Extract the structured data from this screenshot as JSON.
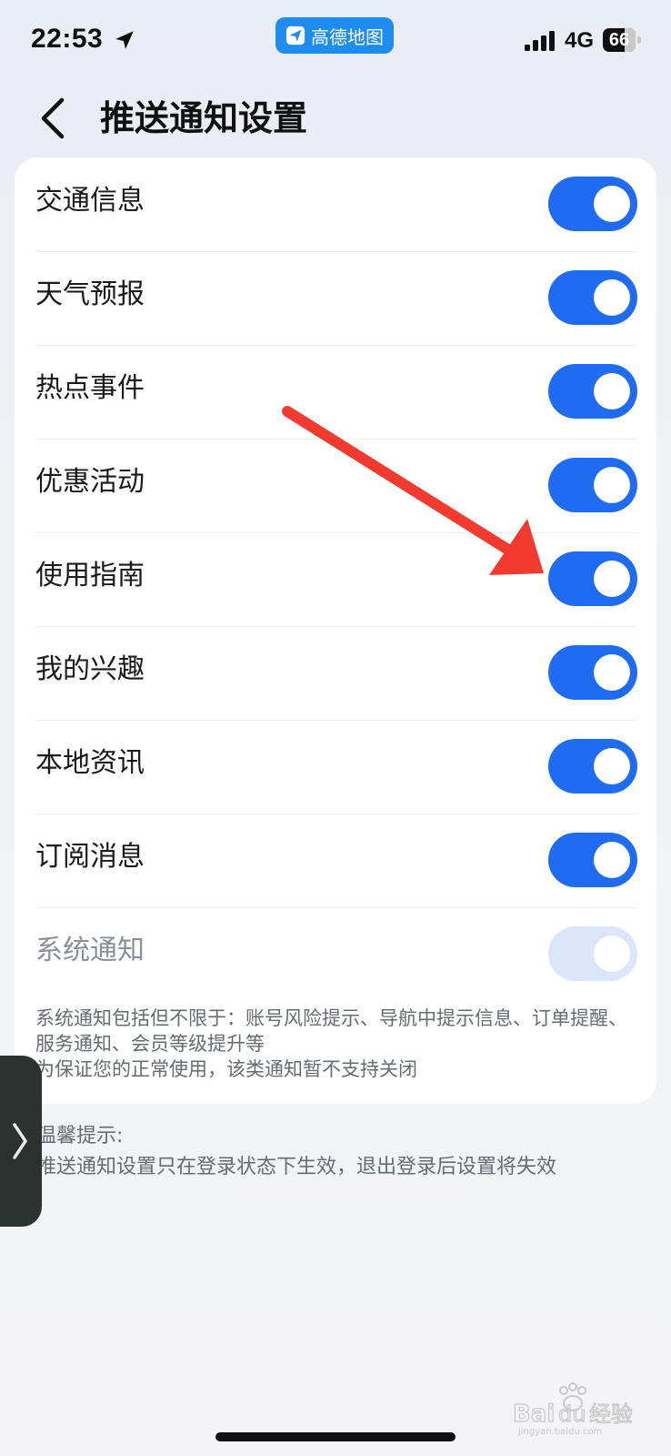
{
  "status_bar": {
    "time": "22:53",
    "app_name": "高德地图",
    "network": "4G",
    "battery": "66",
    "battery_level_fraction": 0.66
  },
  "header": {
    "title": "推送通知设置"
  },
  "settings": [
    {
      "label": "交通信息",
      "enabled": true,
      "editable": true
    },
    {
      "label": "天气预报",
      "enabled": true,
      "editable": true
    },
    {
      "label": "热点事件",
      "enabled": true,
      "editable": true
    },
    {
      "label": "优惠活动",
      "enabled": true,
      "editable": true
    },
    {
      "label": "使用指南",
      "enabled": true,
      "editable": true
    },
    {
      "label": "我的兴趣",
      "enabled": true,
      "editable": true
    },
    {
      "label": "本地资讯",
      "enabled": true,
      "editable": true
    },
    {
      "label": "订阅消息",
      "enabled": true,
      "editable": true
    },
    {
      "label": "系统通知",
      "enabled": true,
      "editable": false
    }
  ],
  "system_note": {
    "line1": "系统通知包括但不限于：账号风险提示、导航中提示信息、订单提醒、服务通知、会员等级提升等",
    "line2": "为保证您的正常使用，该类通知暂不支持关闭"
  },
  "tips": {
    "heading": "温馨提示:",
    "body": "推送通知设置只在登录状态下生效，退出登录后设置将失效"
  },
  "annotation": {
    "arrow_color": "#f23b2e",
    "points_to": "使用指南"
  },
  "colors": {
    "toggle_on": "#1f6bf2",
    "toggle_disabled": "#dce6fb",
    "app_pill": "#1f8cf0"
  },
  "watermark": {
    "text": "Baidu 经验",
    "sub": "jingyan.baidu.com"
  }
}
